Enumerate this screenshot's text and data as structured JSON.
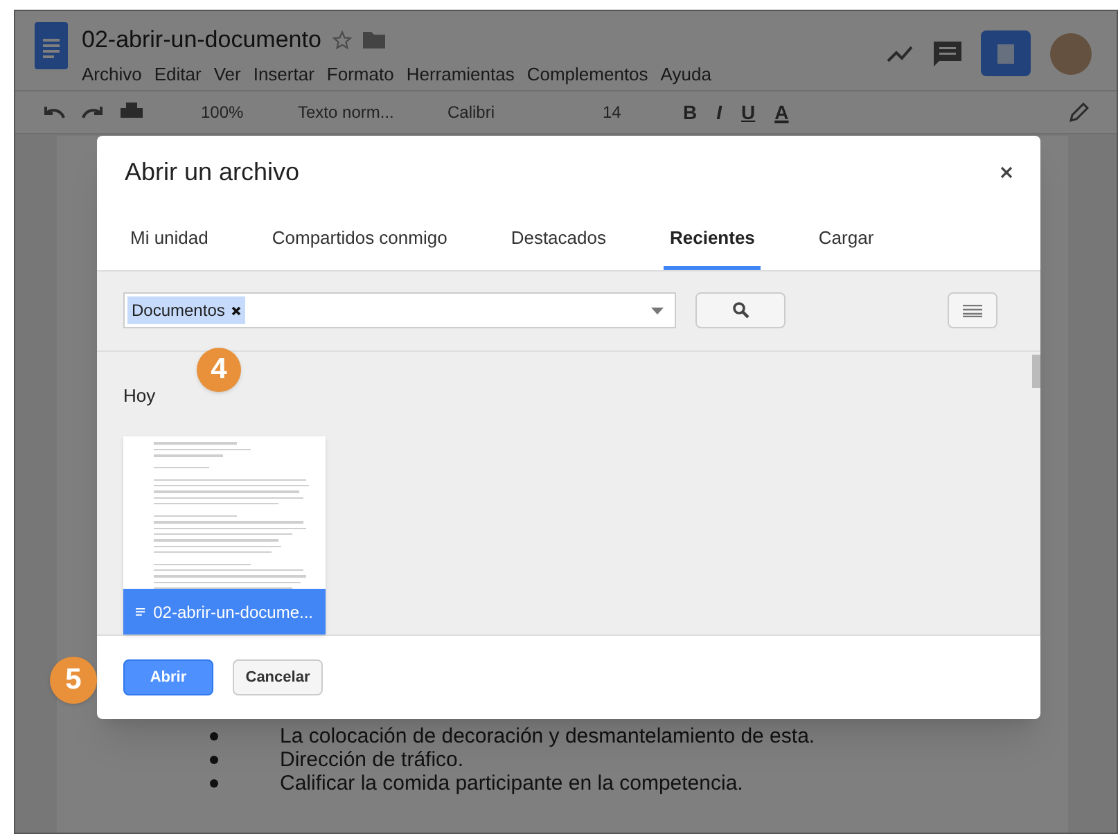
{
  "document": {
    "title": "02-abrir-un-documento",
    "menu": [
      "Archivo",
      "Editar",
      "Ver",
      "Insertar",
      "Formato",
      "Herramientas",
      "Complementos",
      "Ayuda"
    ],
    "toolbar": {
      "zoom": "100%",
      "style": "Texto norm...",
      "font": "Calibri",
      "size": "14",
      "format_buttons": [
        "B",
        "I",
        "U",
        "A"
      ]
    },
    "bullets": [
      "La colocación de decoración y desmantelamiento de esta.",
      "Dirección de tráfico.",
      "Calificar la comida participante en la competencia."
    ]
  },
  "dialog": {
    "title": "Abrir un archivo",
    "tabs": [
      {
        "label": "Mi unidad",
        "selected": false
      },
      {
        "label": "Compartidos conmigo",
        "selected": false
      },
      {
        "label": "Destacados",
        "selected": false
      },
      {
        "label": "Recientes",
        "selected": true
      },
      {
        "label": "Cargar",
        "selected": false
      }
    ],
    "filter_chip": "Documentos",
    "section": "Hoy",
    "files": [
      {
        "name": "02-abrir-un-docume...",
        "selected": true
      }
    ],
    "buttons": [
      {
        "label": "Abrir",
        "kind": "primary"
      },
      {
        "label": "Cancelar",
        "kind": "secondary"
      }
    ]
  },
  "step_badges": [
    "4",
    "5"
  ]
}
